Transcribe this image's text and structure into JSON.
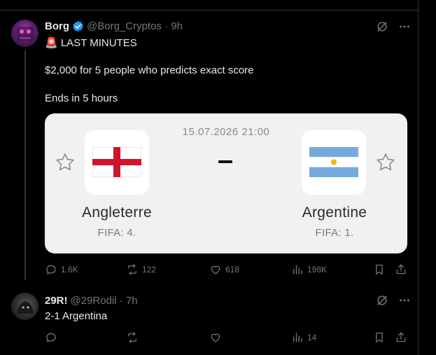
{
  "tweet": {
    "name": "Borg",
    "handle": "@Borg_Cryptos · 9h",
    "line1": "🚨 LAST MINUTES",
    "line2": "$2,000 for 5 people who predicts exact score",
    "line3": "Ends in 5 hours",
    "card": {
      "datetime": "15.07.2026 21:00",
      "home_team": "Angleterre",
      "home_fifa": "FIFA: 4.",
      "away_team": "Argentine",
      "away_fifa": "FIFA: 1."
    },
    "stats": {
      "replies": "1.6K",
      "reposts": "122",
      "likes": "618",
      "views": "198K"
    }
  },
  "reply": {
    "name": "29R!",
    "handle": "@29Rodil · 7h",
    "text": "2-1 Argentina",
    "stats": {
      "views": "14"
    }
  },
  "colors": {
    "background": "#000000",
    "text": "#e7e9ea",
    "muted": "#71767b",
    "verified": "#1d9bf0",
    "card_bg": "#f1f1f2"
  }
}
